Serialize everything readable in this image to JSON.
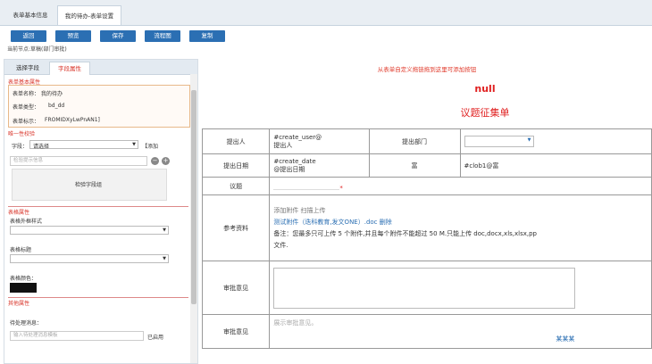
{
  "tabs": {
    "basic": "表单基本信息",
    "design": "我的待办-表单设置"
  },
  "toolbar": {
    "back": "返回",
    "preview": "预览",
    "save": "保存",
    "flow": "流程图",
    "copy": "复制"
  },
  "crumb": "当前节点:草稿(部门审批)",
  "left": {
    "tab_select": "选择字段",
    "tab_attr": "字段属性",
    "sec_basic": "表单基本属性",
    "form_name_label": "表单名称：",
    "form_name": "我的待办",
    "form_type_label": "表单类型：",
    "form_type": "bd_dd",
    "form_mark_label": "表单标示：",
    "form_mark": "FROMIDXyLwPnAN1]",
    "sec_unique": "唯一性校验",
    "field_label": "字段：",
    "field_value": "请选择",
    "add_link": "【添加",
    "check_placeholder": "检验提示信息",
    "check_fields": "检验字段组",
    "sec_style": "表格属性",
    "style_label": "表格外框样式",
    "title_label": "表格标题",
    "color_label": "表格颜色：",
    "sec_other": "其他属性",
    "proc_label": "待处理消息：",
    "proc_placeholder": "输入待处理消息模板",
    "proc_ok": "已启用"
  },
  "right": {
    "hint": "从表单自定义拖链拖到这里可添加按钮",
    "null_text": "null",
    "form_title": "议题征集单",
    "rows": {
      "proposer_label": "提出人",
      "proposer_val1": "#create_user@",
      "proposer_val2": "提出人",
      "dept_label": "提出部门",
      "date_label": "提出日期",
      "date_val1": "#create_date",
      "date_val2": "@提出日期",
      "rich_label": "富",
      "clob_val": "#clob1@富",
      "topic_label": "议题",
      "topic_star": "*",
      "ref_label": "参考资料",
      "ref_actions": "添加附件 扫描上传",
      "ref_file": "测试附件（迭科教育,发文ONE）.doc 删除",
      "ref_note": "备注：您最多只可上传 5 个附件,并且每个附件不能超过 50 M.只能上传 doc,docx,xls,xlsx,pp",
      "ref_note2": "文件.",
      "opinion_label": "审批意见",
      "opinion_label2": "审批意见",
      "opinion_placeholder": "展示审批意见。",
      "signer": "某某某"
    }
  }
}
